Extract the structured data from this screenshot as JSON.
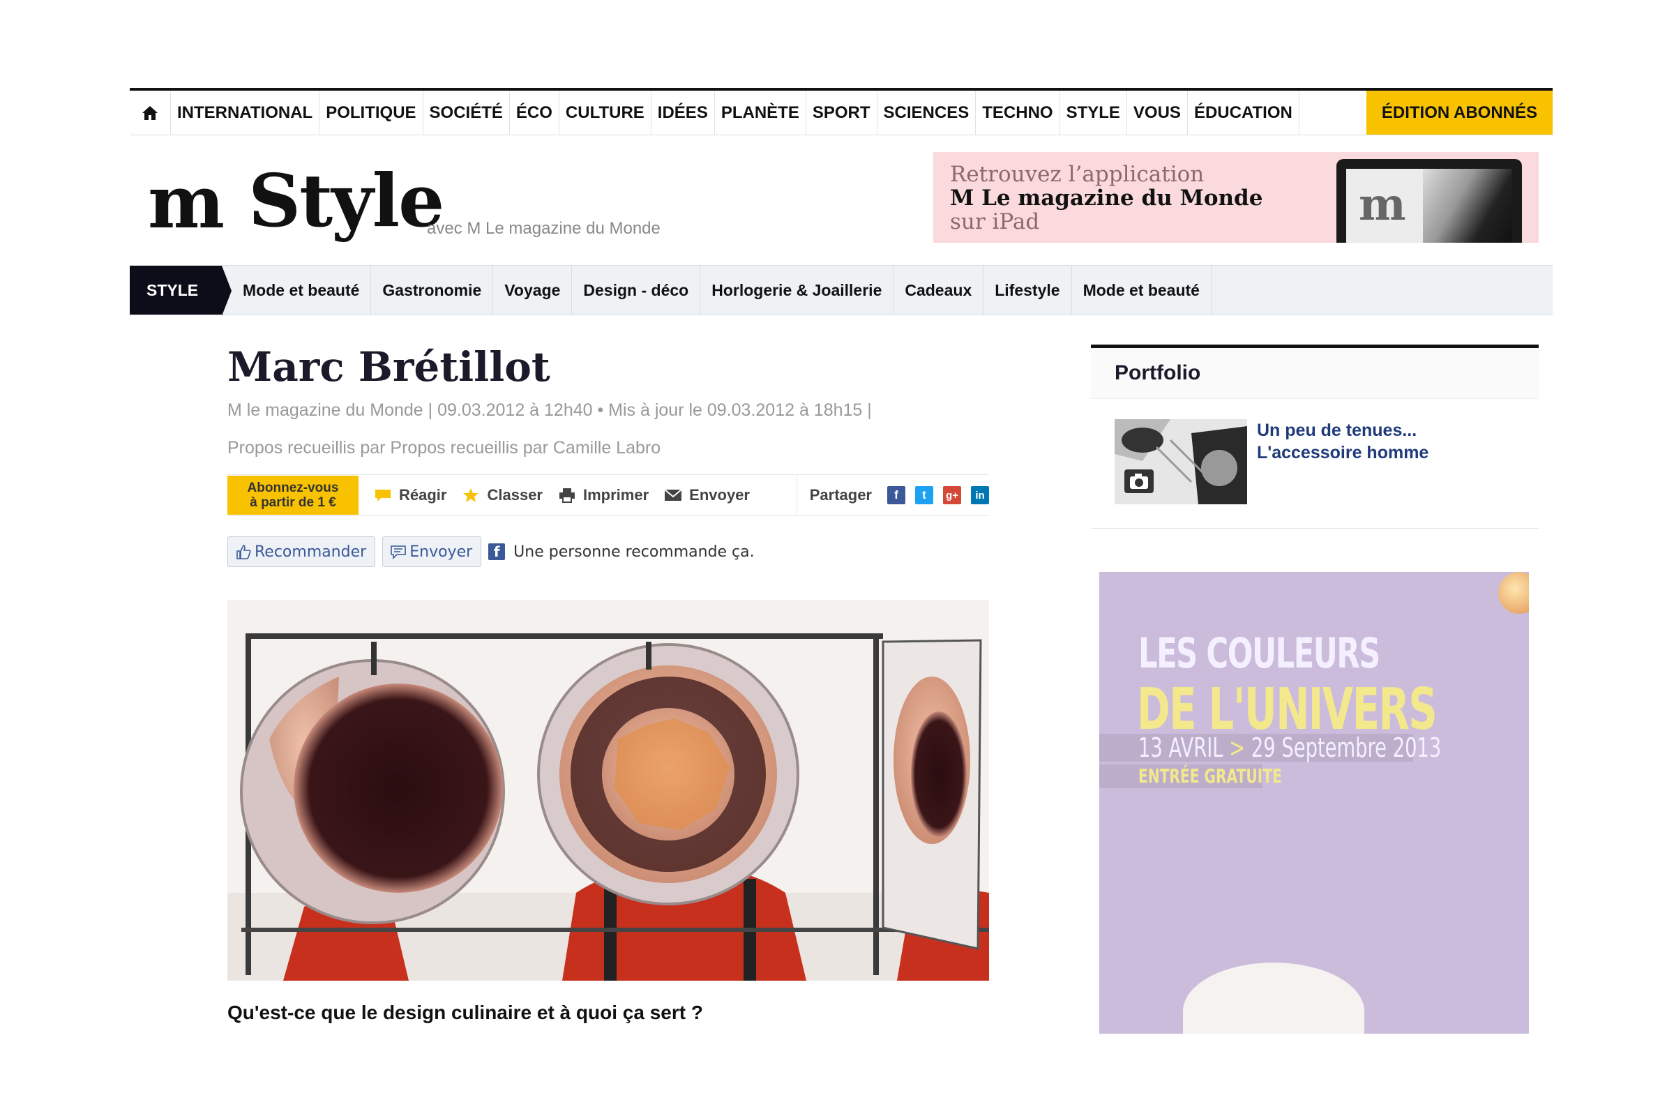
{
  "topnav": {
    "items": [
      "INTERNATIONAL",
      "POLITIQUE",
      "SOCIÉTÉ",
      "ÉCO",
      "CULTURE",
      "IDÉES",
      "PLANÈTE",
      "SPORT",
      "SCIENCES",
      "TECHNO",
      "STYLE",
      "VOUS",
      "ÉDUCATION"
    ],
    "edition": "ÉDITION ABONNÉS"
  },
  "masthead": {
    "logo_m": "m",
    "logo_word": "Style",
    "tagline": "avec M Le magazine du Monde",
    "promo": {
      "line1": "Retrouvez l’application",
      "line2": "M Le magazine du Monde",
      "line3": "sur iPad"
    }
  },
  "subnav": {
    "tag": "STYLE",
    "items": [
      "Mode et beauté",
      "Gastronomie",
      "Voyage",
      "Design - déco",
      "Horlogerie & Joaillerie",
      "Cadeaux",
      "Lifestyle",
      "Mode et beauté"
    ]
  },
  "article": {
    "title": "Marc Brétillot",
    "meta": "M le magazine du Monde | 09.03.2012 à 12h40 • Mis à jour le 09.03.2012 à 18h15 |",
    "byline": "Propos recueillis par Propos recueillis par Camille Labro",
    "abonnez_line1": "Abonnez-vous",
    "abonnez_line2": "à partir de 1 €",
    "tools": [
      "Réagir",
      "Classer",
      "Imprimer",
      "Envoyer"
    ],
    "partager": "Partager",
    "fb": {
      "recommander": "Recommander",
      "envoyer": "Envoyer",
      "text": "Une personne recommande ça."
    },
    "question": "Qu'est-ce que le design culinaire et à quoi ça sert ?"
  },
  "portfolio": {
    "title": "Portfolio",
    "link": "Un peu de tenues... L'accessoire homme"
  },
  "ad": {
    "line1": "LES COULEURS",
    "line2": "DE L'UNIVERS",
    "date_start": "13 AVRIL",
    "arrow": ">",
    "date_end": "29 Septembre 2013",
    "line4": "ENTRÉE GRATUITE"
  },
  "colors": {
    "accent_yellow": "#f8c200",
    "nav_dark": "#0d0d1a",
    "link_blue": "#1f3a7a",
    "promo_pink": "#fadadd",
    "facebook": "#3b5998",
    "twitter": "#1da1f2",
    "gplus": "#d34836",
    "linkedin": "#0077b5"
  },
  "icons": [
    "home-icon",
    "comment-icon",
    "star-icon",
    "print-icon",
    "mail-icon",
    "facebook-icon",
    "twitter-icon",
    "gplus-icon",
    "linkedin-icon",
    "thumbs-up-icon",
    "send-icon",
    "camera-icon"
  ]
}
